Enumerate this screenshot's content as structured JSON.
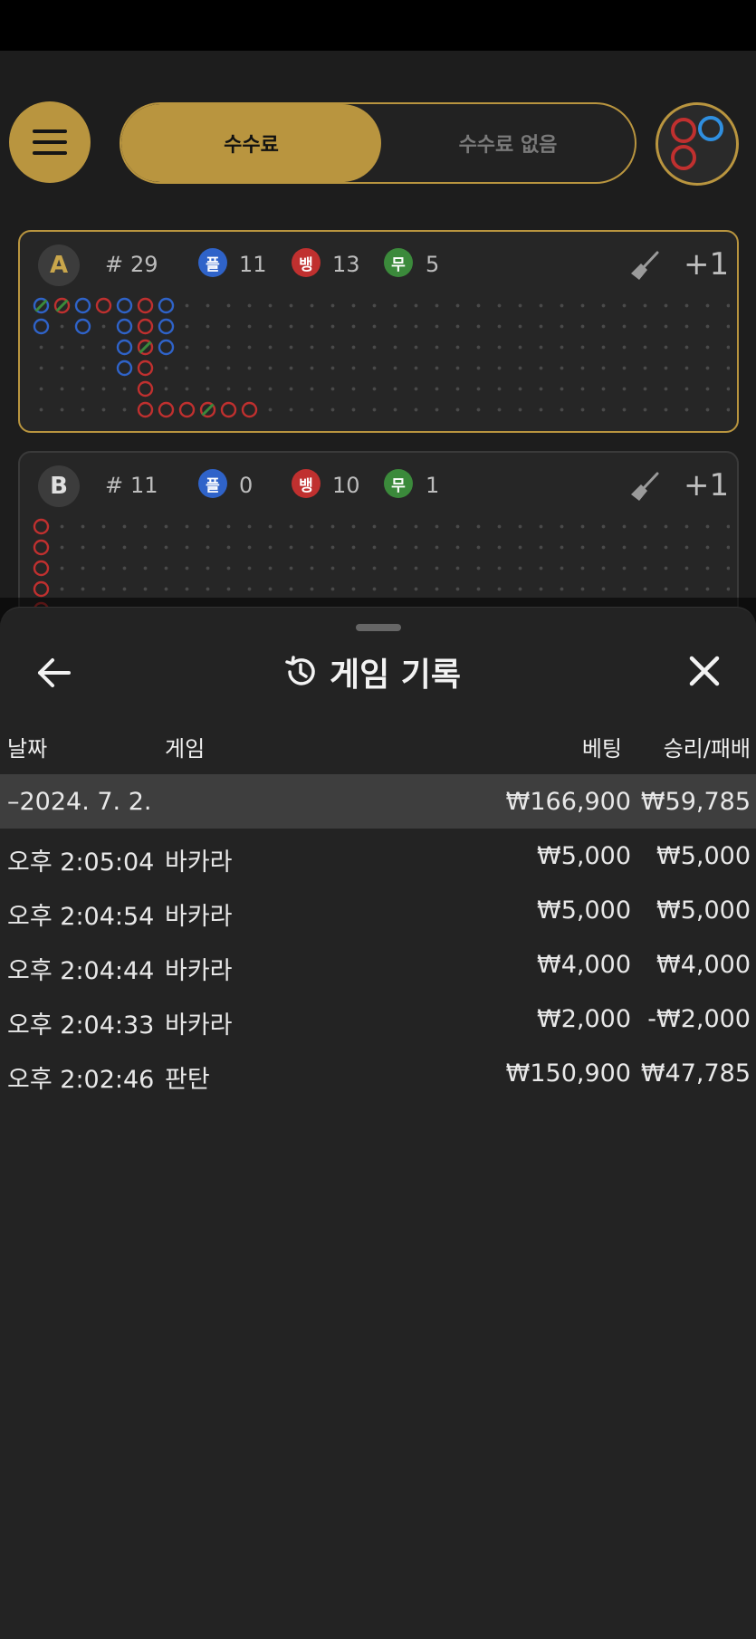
{
  "toggle": {
    "with_fee": "수수료",
    "no_fee": "수수료 없음"
  },
  "roads": [
    {
      "letter": "A",
      "hash": "#",
      "count": "29",
      "player_chip": "플",
      "player": "11",
      "banker_chip": "뱅",
      "banker": "13",
      "tie_chip": "무",
      "tie": "5",
      "plus": "+1"
    },
    {
      "letter": "B",
      "hash": "#",
      "count": "11",
      "player_chip": "플",
      "player": "0",
      "banker_chip": "뱅",
      "banker": "10",
      "tie_chip": "무",
      "tie": "1",
      "plus": "+1"
    }
  ],
  "sheet": {
    "title": "게임 기록",
    "columns": {
      "date": "날짜",
      "game": "게임",
      "bet": "베팅",
      "result": "승리/패배"
    },
    "summary": {
      "date": "–2024. 7. 2.",
      "bet": "₩166,900",
      "result": "₩59,785"
    },
    "rows": [
      {
        "time": "오후 2:05:04",
        "game": "바카라",
        "bet": "₩5,000",
        "result": "₩5,000"
      },
      {
        "time": "오후 2:04:54",
        "game": "바카라",
        "bet": "₩5,000",
        "result": "₩5,000"
      },
      {
        "time": "오후 2:04:44",
        "game": "바카라",
        "bet": "₩4,000",
        "result": "₩4,000"
      },
      {
        "time": "오후 2:04:33",
        "game": "바카라",
        "bet": "₩2,000",
        "result": "-₩2,000"
      },
      {
        "time": "오후 2:02:46",
        "game": "판탄",
        "bet": "₩150,900",
        "result": "₩47,785"
      }
    ]
  },
  "icons": {
    "menu": "hamburger-icon",
    "back": "arrow-left-icon",
    "close": "close-icon",
    "history": "history-icon",
    "broom": "broom-icon",
    "logo": "circles-logo-icon"
  },
  "colors": {
    "gold": "#b9953f",
    "player": "#2f63c9",
    "banker": "#c0302f",
    "tie": "#3b8a3b",
    "background": "#1d1d1d",
    "sheet": "#232323"
  }
}
